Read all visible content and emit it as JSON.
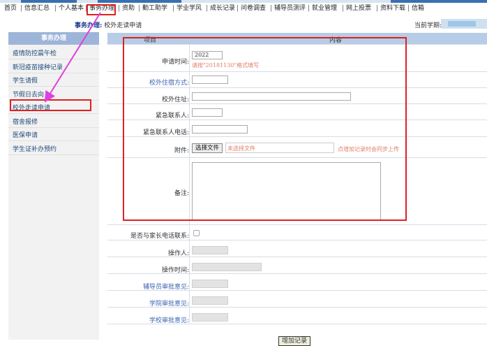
{
  "nav": {
    "items": [
      "首页",
      "信息汇总",
      "个人基本",
      "事务办理",
      "资助",
      "勤工助学",
      "学业学风",
      "成长记录",
      "问卷调查",
      "辅导员测评",
      "就业管理",
      "网上投票",
      "资料下载",
      "信箱"
    ],
    "active": "事务办理"
  },
  "breadcrumb": {
    "section": "事务办理:",
    "page": "校外走读申请"
  },
  "term": {
    "label": "当前学期:"
  },
  "sidebar": {
    "title": "事务办理",
    "items": [
      "疫情防控晨午检",
      "新冠疫苗接种记录",
      "学生请假",
      "节假日去向",
      "校外走读申请",
      "宿舍报修",
      "医保申请",
      "学生证补办预约"
    ],
    "selected": "校外走读申请"
  },
  "table": {
    "col_item": "项目",
    "col_content": "内容"
  },
  "form": {
    "apply_time_label": "申请时间:",
    "apply_time_value": "2022",
    "apply_time_hint": "请按\"20181130\"格式填写",
    "dorm_label": "校外住宿方式:",
    "address_label": "校外住址:",
    "contact_label": "紧急联系人:",
    "contact_phone_label": "紧急联系人电话:",
    "attachment_label": "附件:",
    "file_button": "选择文件",
    "file_none": "未选择文件",
    "file_hint": "点增加记录时会同步上传",
    "remark_label": "备注:",
    "parent_contact_label": "是否与家长电话联系:",
    "operator_label": "操作人:",
    "operate_time_label": "操作时间:",
    "counselor_label": "辅导员审批意见:",
    "college_label": "学院审批意见:",
    "school_label": "学校审批意见:",
    "add_button": "增加记录"
  }
}
